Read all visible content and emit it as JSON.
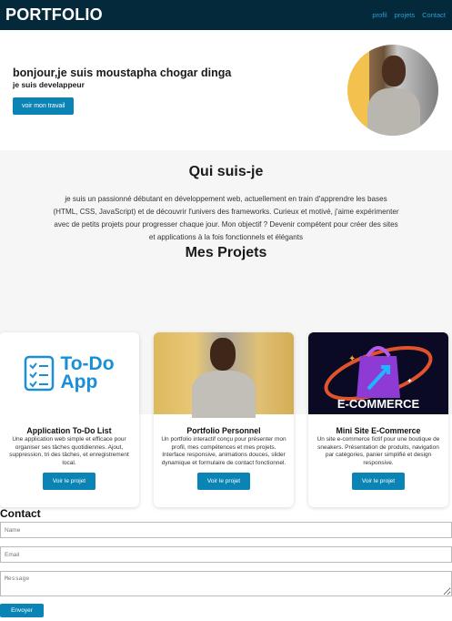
{
  "nav": {
    "logo": "PORTFOLIO",
    "links": [
      "profil",
      "projets",
      "Contact"
    ]
  },
  "hero": {
    "greeting": "bonjour,je suis moustapha chogar dinga",
    "role": "je suis develappeur",
    "button": "voir mon travail"
  },
  "about": {
    "title": "Qui suis-je",
    "text": "je suis un passionné débutant en développement web, actuellement en train d'apprendre les bases (HTML, CSS, JavaScript) et de découvrir l'univers des frameworks. Curieux et motivé, j'aime expérimenter avec de petits projets pour progresser chaque jour. Mon objectif ? Devenir compétent pour créer des sites et applications à la fois fonctionnels et élégants"
  },
  "projects": {
    "title": "Mes Projets",
    "items": [
      {
        "image_text": [
          "To-Do",
          "App"
        ],
        "title": "Application To-Do List",
        "description": "Une application web simple et efficace pour organiser ses tâches quotidiennes. Ajout, suppression, tri des tâches, et enregistrement local.",
        "button": "Voir le projet"
      },
      {
        "title": "Portfolio Personnel",
        "description": "Un portfolio interactif conçu pour présenter mon profil, mes compétences et mes projets. Interface responsive, animations douces, slider dynamique et formulaire de contact fonctionnel.",
        "button": "Voir le projet"
      },
      {
        "image_text": "E-COMMERCE",
        "title": "Mini Site E-Commerce",
        "description": "Un site e-commerce fictif pour une boutique de sneakers. Présentation de produits, navigation par catégories, panier simplifié et design responsive.",
        "button": "Voir le projet"
      }
    ]
  },
  "contact": {
    "title": "Contact",
    "name_placeholder": "Name",
    "email_placeholder": "Email",
    "message_placeholder": "Message",
    "submit": "Envoyer"
  },
  "colors": {
    "nav_bg": "#04293a",
    "accent": "#0a84b5",
    "link": "#2a9fd6"
  }
}
